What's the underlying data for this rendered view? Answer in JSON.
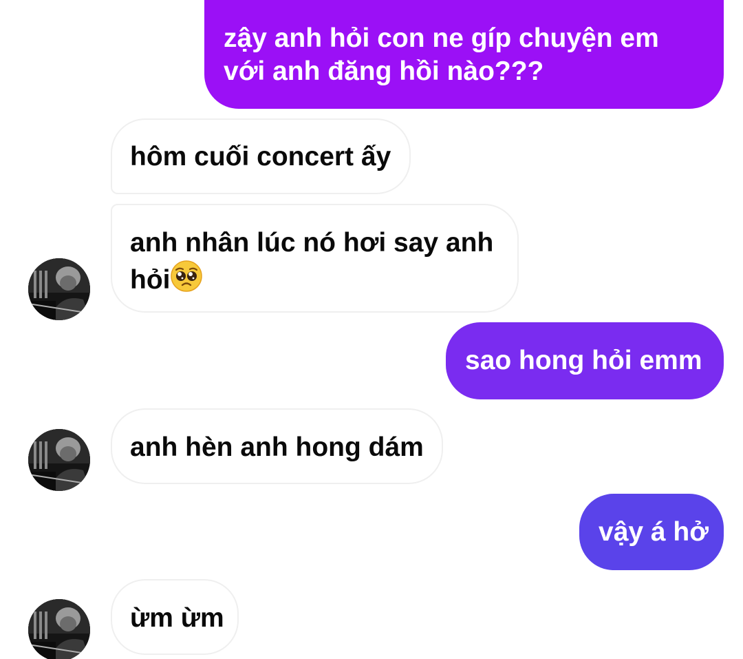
{
  "theme": {
    "outgoing_top_color": "#9B10F6",
    "outgoing_mid_color": "#7A2CF0",
    "outgoing_low_color": "#5A43EA",
    "incoming_bg": "#FFFFFF",
    "incoming_border": "#EFEFEF"
  },
  "messages": [
    {
      "sender": "me",
      "line1": "zậy anh hỏi con ne gíp chuyện em",
      "line2": "với anh đăng hồi nào???"
    },
    {
      "sender": "them",
      "text": "hôm cuối concert ấy"
    },
    {
      "sender": "them",
      "line1": "anh nhân lúc nó hơi say anh",
      "line2": "hỏi",
      "emoji": "pleading-face-emoji"
    },
    {
      "sender": "me",
      "text": "sao hong hỏi emm"
    },
    {
      "sender": "them",
      "text": "anh hèn anh hong dám"
    },
    {
      "sender": "me",
      "text": "vậy á hở"
    },
    {
      "sender": "them",
      "text": "ừm ừm"
    }
  ],
  "avatar": {
    "icon": "profile-photo-avatar"
  }
}
